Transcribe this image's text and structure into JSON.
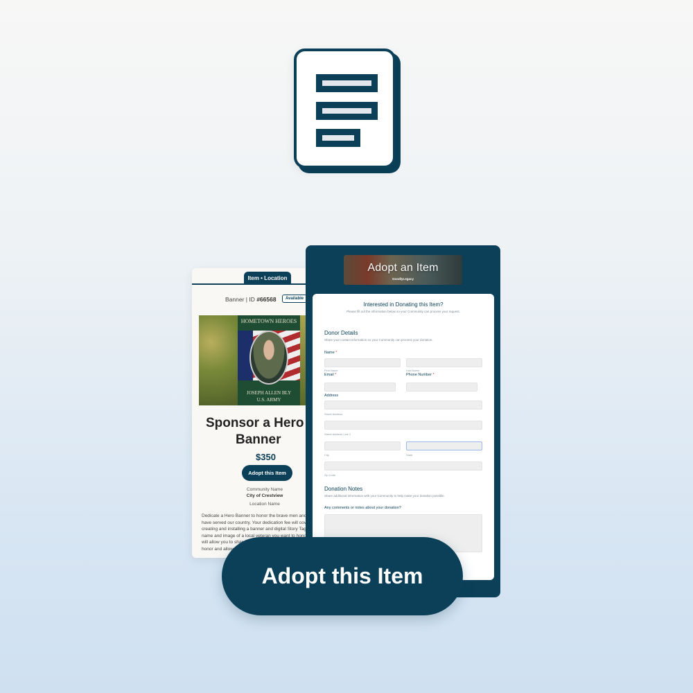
{
  "icon": {
    "name": "form-document-icon"
  },
  "item_card": {
    "tab_label": "Item • Location",
    "id_prefix": "Banner | ID ",
    "id_value": "#66568",
    "status_badge": "Available",
    "photo": {
      "banner_header": "HOMETOWN HEROES",
      "banner_name": "JOSEPH ALLEN BLY",
      "banner_branch": "U.S. ARMY"
    },
    "title_line1": "Sponsor a Hero",
    "title_line2": "Banner",
    "price": "$350",
    "adopt_button": "Adopt this Item",
    "community_label": "Community Name",
    "community_value": "City of Crestview",
    "location_label": "Location Name",
    "description": "Dedicate a Hero Banner to honor the brave men and women who have served our country. Your dedication fee will cover the cost of creating and installing a banner and digital Story Tag featuring the name and image of a local veteran you want to honor. The Story Tag will allow you to share the story of the veteran you have chosen to honor and allow the community to learn more about them."
  },
  "donation_form": {
    "hero_title": "Adopt an Item",
    "hero_brand": "GoodlyLegacy",
    "title": "Interested in Donating this Item?",
    "subtitle": "Please fill out the information below so your Community can process your request.",
    "donor_section": {
      "title": "Donor Details",
      "subtitle": "Share your contact information so your Community can process your donation."
    },
    "fields": {
      "name_label": "Name",
      "first_name_hint": "First Name",
      "last_name_hint": "Last Name",
      "email_label": "Email",
      "phone_label": "Phone Number",
      "address_label": "Address",
      "street_hint": "Street Address",
      "street2_hint": "Street Address Line 2",
      "city_hint": "City",
      "state_hint": "State",
      "zip_hint": "Zip Code",
      "required_mark": "*"
    },
    "notes_section": {
      "title": "Donation Notes",
      "subtitle": "Share additional information with your Community to help make your donation possible.",
      "comments_label": "Any comments or notes about your donation?"
    }
  },
  "cta": {
    "label": "Adopt this Item"
  },
  "colors": {
    "brand": "#0b4058",
    "required": "#dd3333"
  }
}
